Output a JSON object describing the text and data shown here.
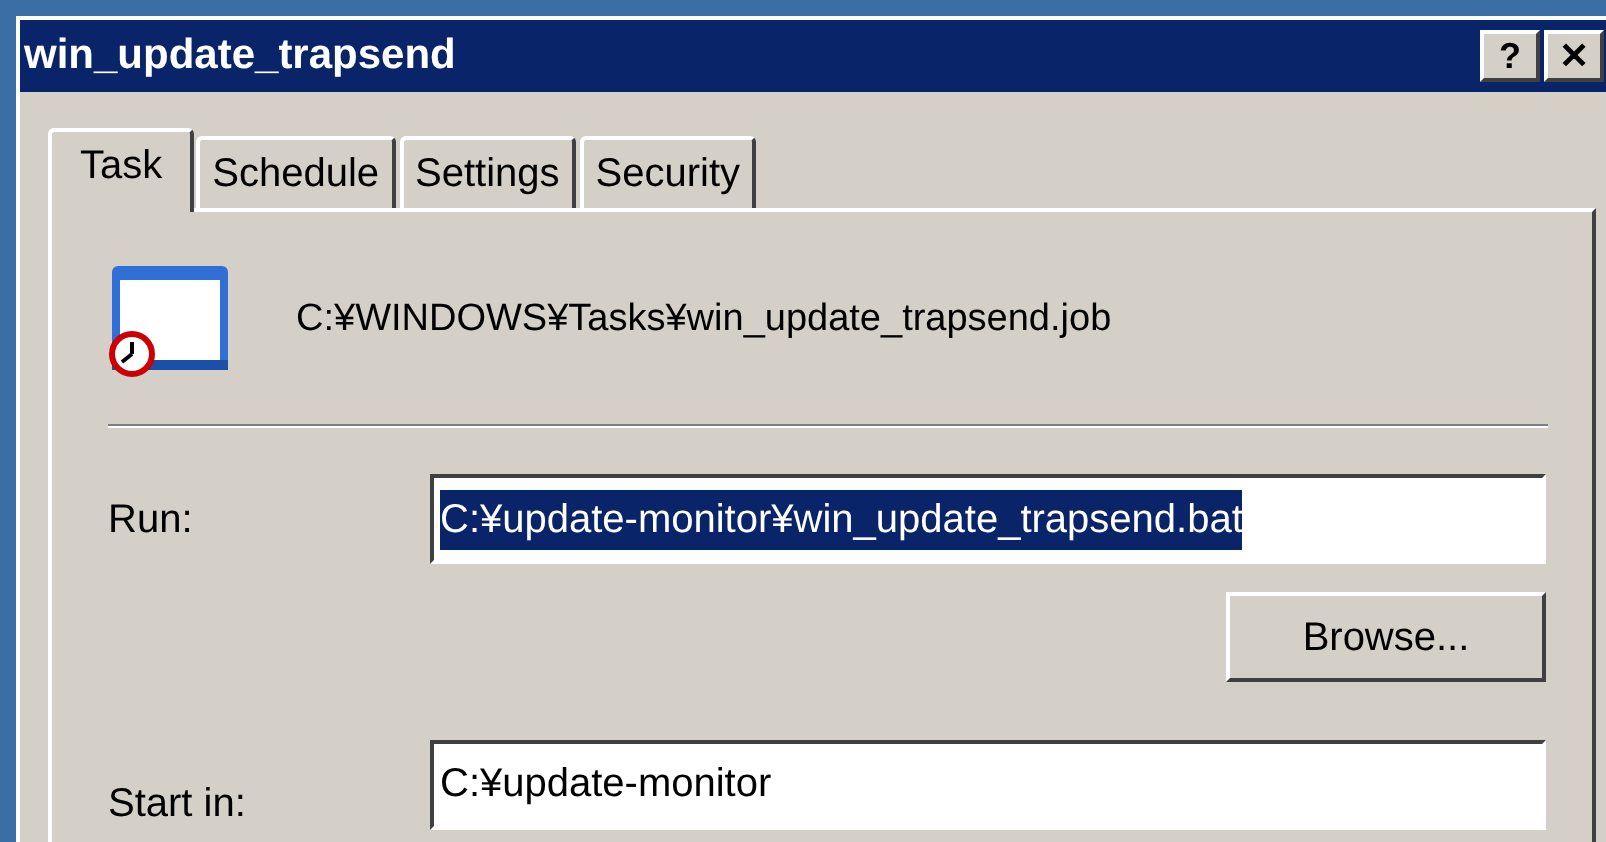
{
  "window": {
    "title": "win_update_trapsend",
    "buttons": [
      "?",
      "✕"
    ]
  },
  "tabs": [
    {
      "label": "Task",
      "selected": true
    },
    {
      "label": "Schedule",
      "selected": false
    },
    {
      "label": "Settings",
      "selected": false
    },
    {
      "label": "Security",
      "selected": false
    }
  ],
  "task": {
    "path": "C:¥WINDOWS¥Tasks¥win_update_trapsend.job",
    "run": {
      "label": "Run:",
      "value": "C:¥update-monitor¥win_update_trapsend.bat",
      "selected": true
    },
    "browse_button": "Browse...",
    "start_in": {
      "label": "Start in:",
      "value": "C:¥update-monitor",
      "selected": false
    }
  }
}
